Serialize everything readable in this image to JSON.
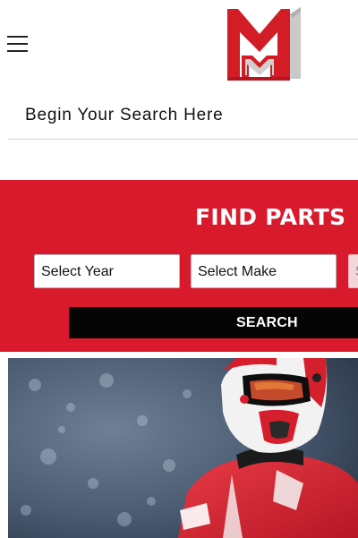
{
  "header": {
    "menu_icon": "hamburger-menu-icon",
    "logo_icon": "m1-logo-icon",
    "brand_colors": {
      "red": "#d9192c",
      "gray": "#c8c8c8"
    }
  },
  "search": {
    "prompt": "Begin Your Search Here"
  },
  "find_parts": {
    "title": "FIND PARTS",
    "background": "#d9192c",
    "selects": [
      {
        "label": "Select Year"
      },
      {
        "label": "Select Make"
      },
      {
        "label": "S"
      }
    ],
    "search_button": "SEARCH"
  },
  "hero": {
    "image_icon": "motocross-rider-image"
  }
}
